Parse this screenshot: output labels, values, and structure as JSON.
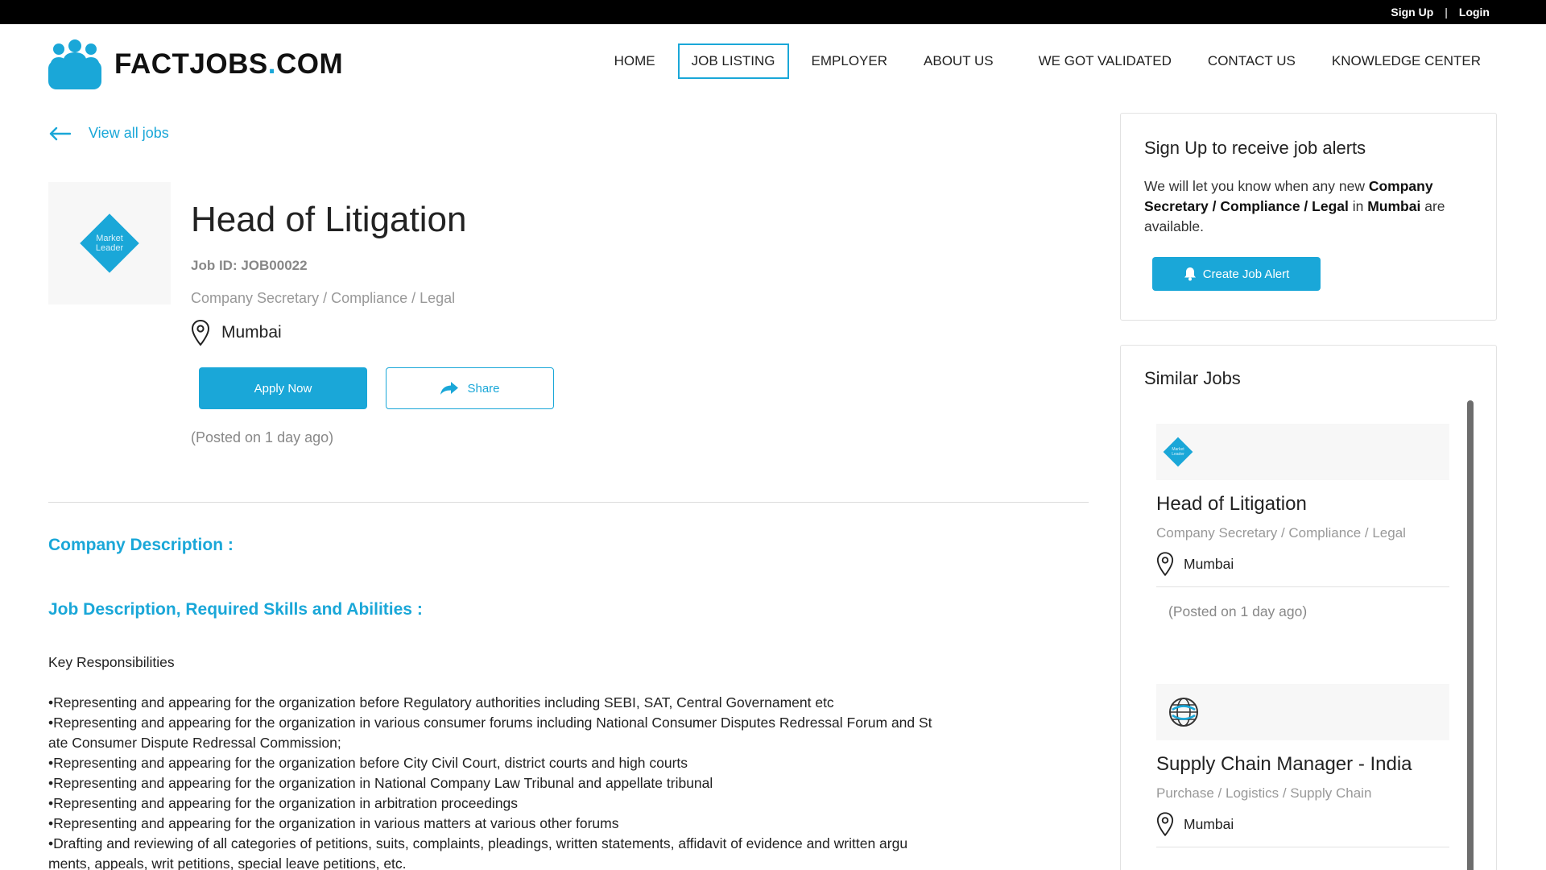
{
  "topbar": {
    "signup": "Sign Up",
    "separator": "|",
    "login": "Login"
  },
  "brand": {
    "name": "FACTJOBS",
    "dot": ".",
    "tld": "COM",
    "color": "#1aa7d8"
  },
  "nav": {
    "items": [
      {
        "label": "HOME"
      },
      {
        "label": "JOB LISTING",
        "active": true
      },
      {
        "label": "EMPLOYER"
      },
      {
        "label": "ABOUT US"
      },
      {
        "label": "WE GOT VALIDATED"
      },
      {
        "label": "CONTACT US"
      },
      {
        "label": "KNOWLEDGE CENTER"
      }
    ]
  },
  "back": {
    "label": "View all jobs",
    "icon": "arrow-left-icon"
  },
  "job": {
    "company_logo_text": "Market Leader",
    "title": "Head of Litigation",
    "id_label": "Job ID: JOB00022",
    "category": "Company Secretary / Compliance / Legal",
    "location": "Mumbai",
    "apply_label": "Apply Now",
    "share_label": "Share",
    "posted": "(Posted on 1 day ago)"
  },
  "sections": {
    "company_description": "Company Description :",
    "job_description": "Job Description, Required Skills and Abilities :"
  },
  "description": {
    "heading": "Key Responsibilities",
    "lines": [
      "•Representing and appearing for the organization before Regulatory authorities including SEBI, SAT, Central Governament etc",
      "•Representing and appearing for the organization in various consumer forums including National Consumer Disputes Redressal Forum and St",
      "ate Consumer Dispute Redressal Commission;",
      "•Representing and appearing for the organization before City Civil Court, district courts and high courts",
      "•Representing and appearing for the organization in National Company Law Tribunal and appellate tribunal",
      "•Representing and appearing for the organization in arbitration proceedings",
      "•Representing and appearing for the organization in various matters at various other forums",
      "•Drafting and reviewing of all categories of petitions, suits, complaints, pleadings, written statements, affidavit of evidence and written argu",
      "ments, appeals, writ petitions, special leave petitions, etc."
    ]
  },
  "alert": {
    "heading": "Sign Up to receive job alerts",
    "text_pre": "We will let you know when any new ",
    "category": "Company Secretary / Compliance / Legal",
    "text_mid": " in ",
    "location": "Mumbai",
    "text_post": " are available.",
    "button_label": "Create Job Alert",
    "button_icon": "bell-icon"
  },
  "similar": {
    "heading": "Similar Jobs",
    "items": [
      {
        "logo_text": "Market Leader",
        "title": "Head of Litigation",
        "category": "Company Secretary / Compliance / Legal",
        "location": "Mumbai",
        "posted": "(Posted on 1 day ago)"
      },
      {
        "logo_icon": "globe-icon",
        "title": "Supply Chain Manager - India",
        "category": "Purchase / Logistics / Supply Chain",
        "location": "Mumbai"
      }
    ]
  }
}
